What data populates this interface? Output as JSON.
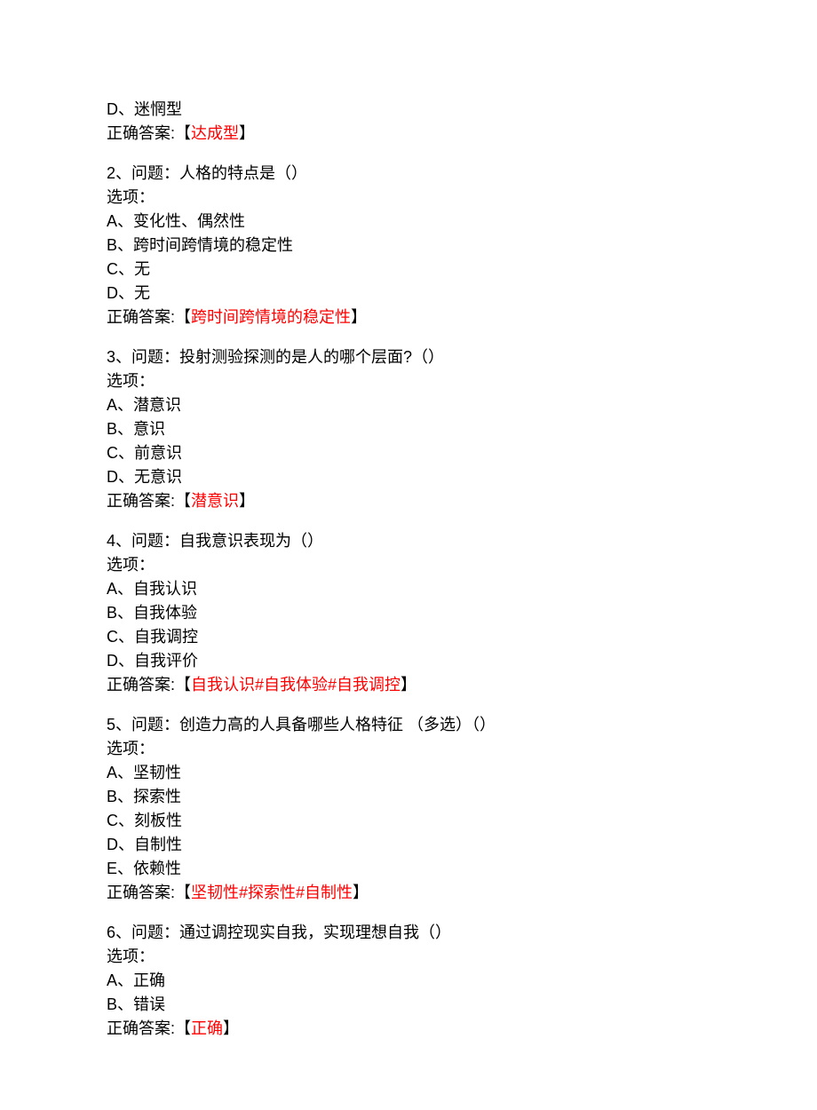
{
  "top": {
    "optionD": "D、迷惘型",
    "answerLabel": "正确答案:",
    "answerOpen": "【",
    "answerValue": "达成型",
    "answerClose": "】"
  },
  "q2": {
    "header": "2、问题：人格的特点是（）",
    "optionsLabel": "选项：",
    "optA": "A、变化性、偶然性",
    "optB": "B、跨时间跨情境的稳定性",
    "optC": "C、无",
    "optD": "D、无",
    "answerLabel": "正确答案:",
    "answerOpen": "【",
    "answerValue": "跨时间跨情境的稳定性",
    "answerClose": "】"
  },
  "q3": {
    "header": "3、问题：投射测验探测的是人的哪个层面?（）",
    "optionsLabel": "选项：",
    "optA": "A、潜意识",
    "optB": "B、意识",
    "optC": "C、前意识",
    "optD": "D、无意识",
    "answerLabel": "正确答案:",
    "answerOpen": "【",
    "answerValue": "潜意识",
    "answerClose": "】"
  },
  "q4": {
    "header": "4、问题：自我意识表现为（）",
    "optionsLabel": "选项：",
    "optA": "A、自我认识",
    "optB": "B、自我体验",
    "optC": "C、自我调控",
    "optD": "D、自我评价",
    "answerLabel": "正确答案:",
    "answerOpen": "【",
    "answerValue": "自我认识#自我体验#自我调控",
    "answerClose": "】"
  },
  "q5": {
    "header": "5、问题：创造力高的人具备哪些人格特征 （多选）（）",
    "optionsLabel": "选项：",
    "optA": "A、坚韧性",
    "optB": "B、探索性",
    "optC": "C、刻板性",
    "optD": "D、自制性",
    "optE": "E、依赖性",
    "answerLabel": "正确答案:",
    "answerOpen": "【",
    "answerValue": "坚韧性#探索性#自制性",
    "answerClose": "】"
  },
  "q6": {
    "header": "6、问题：通过调控现实自我，实现理想自我（）",
    "optionsLabel": "选项：",
    "optA": "A、正确",
    "optB": "B、错误",
    "answerLabel": "正确答案:",
    "answerOpen": "【",
    "answerValue": "正确",
    "answerClose": "】"
  }
}
